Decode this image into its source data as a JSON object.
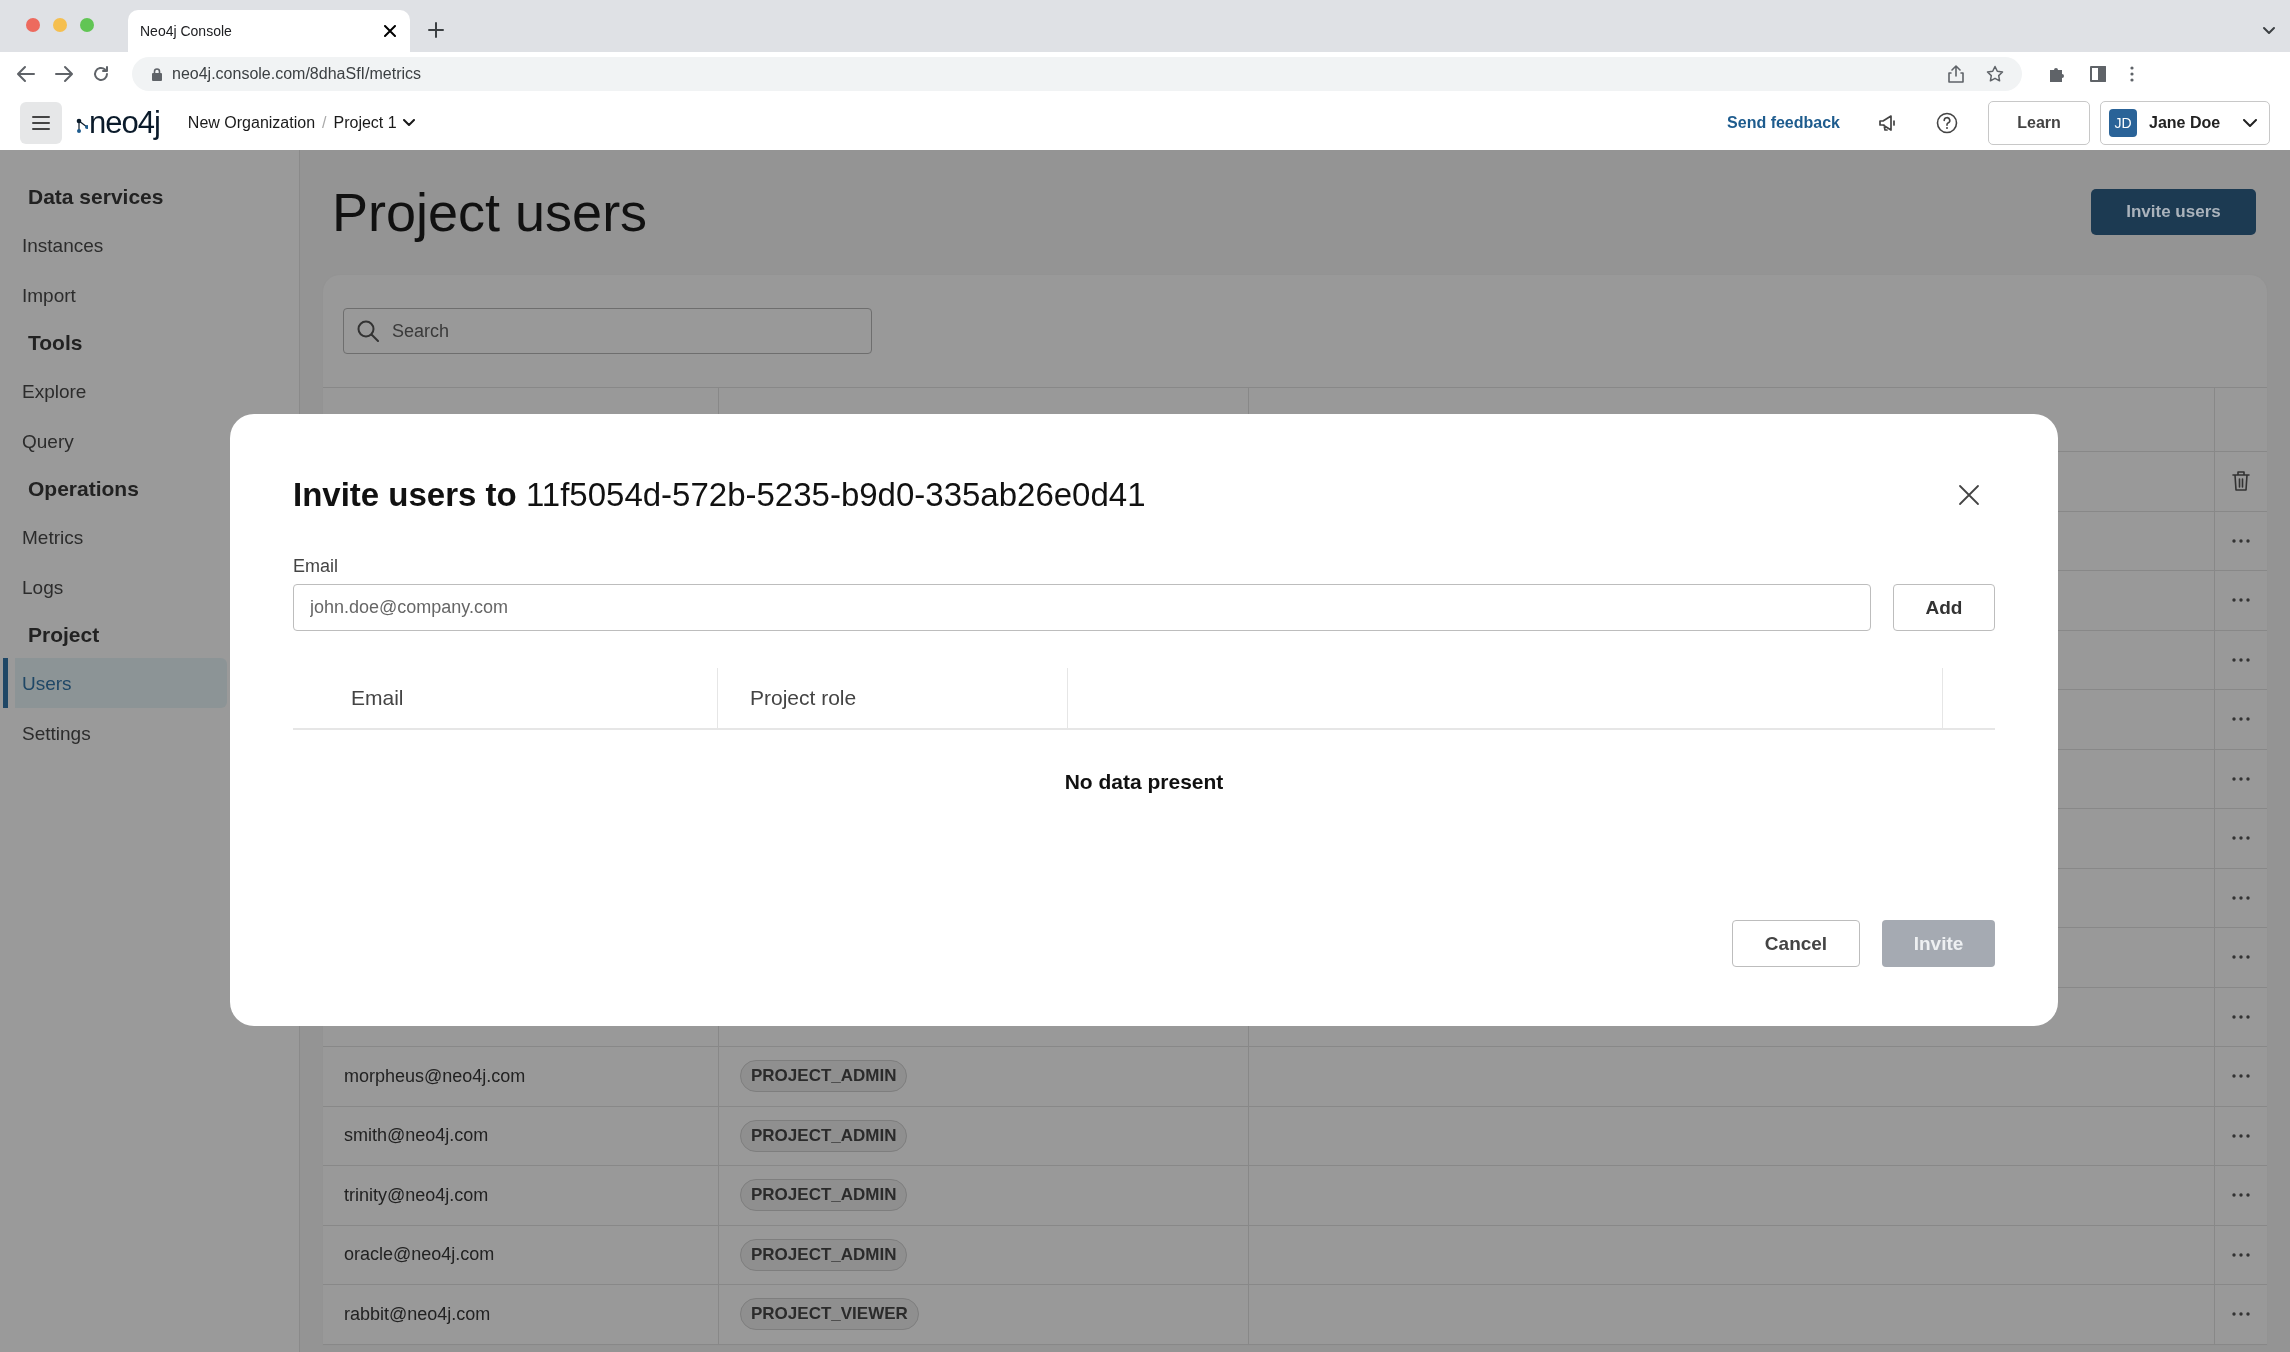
{
  "browser": {
    "tab_title": "Neo4j Console",
    "url": "neo4j.console.com/8dhaSfI/metrics"
  },
  "header": {
    "logo": "neo4j",
    "organization": "New Organization",
    "separator": "/",
    "project": "Project 1",
    "send_feedback": "Send feedback",
    "learn": "Learn",
    "user": {
      "initials": "JD",
      "name": "Jane Doe"
    }
  },
  "sidebar": {
    "sections": [
      {
        "title": "Data services",
        "items": [
          {
            "label": "Instances",
            "selected": false
          },
          {
            "label": "Import",
            "selected": false
          }
        ]
      },
      {
        "title": "Tools",
        "items": [
          {
            "label": "Explore",
            "selected": false
          },
          {
            "label": "Query",
            "selected": false
          }
        ]
      },
      {
        "title": "Operations",
        "items": [
          {
            "label": "Metrics",
            "selected": false
          },
          {
            "label": "Logs",
            "selected": false
          }
        ]
      },
      {
        "title": "Project",
        "items": [
          {
            "label": "Users",
            "selected": true
          },
          {
            "label": "Settings",
            "selected": false
          }
        ]
      }
    ]
  },
  "page": {
    "title": "Project users",
    "invite_button": "Invite users",
    "search": {
      "placeholder": "Search"
    },
    "rows": [
      {
        "kind": "delete"
      },
      {
        "kind": "more"
      },
      {
        "kind": "more"
      },
      {
        "kind": "more"
      },
      {
        "kind": "more"
      },
      {
        "kind": "more"
      },
      {
        "kind": "more"
      },
      {
        "kind": "more"
      },
      {
        "kind": "more"
      },
      {
        "kind": "more"
      },
      {
        "email": "morpheus@neo4j.com",
        "role": "PROJECT_ADMIN",
        "kind": "more"
      },
      {
        "email": "smith@neo4j.com",
        "role": "PROJECT_ADMIN",
        "kind": "more"
      },
      {
        "email": "trinity@neo4j.com",
        "role": "PROJECT_ADMIN",
        "kind": "more"
      },
      {
        "email": "oracle@neo4j.com",
        "role": "PROJECT_ADMIN",
        "kind": "more"
      },
      {
        "email": "rabbit@neo4j.com",
        "role": "PROJECT_VIEWER",
        "kind": "more"
      }
    ]
  },
  "modal": {
    "title": "Invite users to",
    "project_id": "11f5054d-572b-5235-b9d0-335ab26e0d41",
    "email_label": "Email",
    "email_placeholder": "john.doe@company.com",
    "add_button": "Add",
    "columns": [
      "Email",
      "Project role"
    ],
    "empty_text": "No data present",
    "cancel_button": "Cancel",
    "invite_button": {
      "label": "Invite",
      "disabled": true
    }
  }
}
